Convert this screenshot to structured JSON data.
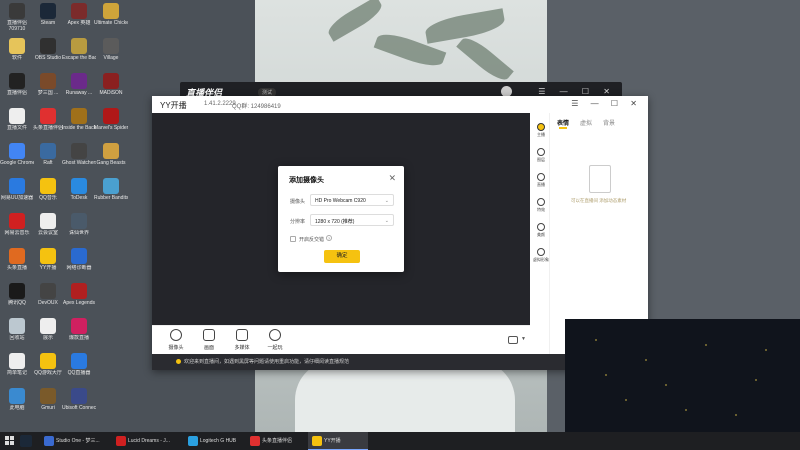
{
  "desktop": {
    "icons": [
      {
        "label": "直播伴侣",
        "sub": "709710",
        "col": 0,
        "row": 0,
        "color": "#3a3a3a"
      },
      {
        "label": "Steam",
        "col": 1,
        "row": 0,
        "color": "#1b2838"
      },
      {
        "label": "Apex 英雄",
        "col": 2,
        "row": 0,
        "color": "#7b2b2b"
      },
      {
        "label": "Ultimate Chicke...",
        "col": 3,
        "row": 0,
        "color": "#cfa43a"
      },
      {
        "label": "软件",
        "col": 0,
        "row": 1,
        "color": "#e6c45a"
      },
      {
        "label": "OBS Studio",
        "col": 1,
        "row": 1,
        "color": "#303030"
      },
      {
        "label": "Escape the Backrooms",
        "col": 2,
        "row": 1,
        "color": "#b89b40"
      },
      {
        "label": "Village",
        "col": 3,
        "row": 1,
        "color": "#5b5b5b"
      },
      {
        "label": "直播伴侣",
        "col": 0,
        "row": 2,
        "color": "#222"
      },
      {
        "label": "梦三国 ...",
        "col": 1,
        "row": 2,
        "color": "#7a4a2a"
      },
      {
        "label": "Runaway ...",
        "col": 2,
        "row": 2,
        "color": "#6b2a8a"
      },
      {
        "label": "MADiSON",
        "col": 3,
        "row": 2,
        "color": "#8a2020"
      },
      {
        "label": "直播文件",
        "col": 0,
        "row": 3,
        "color": "#eeeeee"
      },
      {
        "label": "头条直播伴侣",
        "col": 1,
        "row": 3,
        "color": "#e03030"
      },
      {
        "label": "Inside the Backrooms",
        "col": 2,
        "row": 3,
        "color": "#a0701a"
      },
      {
        "label": "Marvel's Spider-M...",
        "col": 3,
        "row": 3,
        "color": "#b01818"
      },
      {
        "label": "Google Chrome",
        "col": 0,
        "row": 4,
        "color": "#4285f4"
      },
      {
        "label": "Raft",
        "col": 1,
        "row": 4,
        "color": "#3a6aa0"
      },
      {
        "label": "Ghost Watchers",
        "col": 2,
        "row": 4,
        "color": "#444"
      },
      {
        "label": "Gang Beasts",
        "col": 3,
        "row": 4,
        "color": "#d0a040"
      },
      {
        "label": "网易UU加速器",
        "col": 0,
        "row": 5,
        "color": "#2a7ae0"
      },
      {
        "label": "QQ音乐",
        "col": 1,
        "row": 5,
        "color": "#f5c210"
      },
      {
        "label": "ToDesk",
        "col": 2,
        "row": 5,
        "color": "#2a8ae0"
      },
      {
        "label": "Rubber Bandits",
        "col": 3,
        "row": 5,
        "color": "#4aa0d0"
      },
      {
        "label": "网易云音乐",
        "col": 0,
        "row": 6,
        "color": "#d02020"
      },
      {
        "label": "云会议室",
        "col": 1,
        "row": 6,
        "color": "#eeeeee"
      },
      {
        "label": "诛仙世界",
        "col": 2,
        "row": 6,
        "color": "#4a5a6a"
      },
      {
        "label": "头条直播",
        "col": 0,
        "row": 7,
        "color": "#e06a20"
      },
      {
        "label": "YY开播",
        "col": 1,
        "row": 7,
        "color": "#f5c210"
      },
      {
        "label": "网络诊断器",
        "col": 2,
        "row": 7,
        "color": "#2a6ad0"
      },
      {
        "label": "腾讯QQ",
        "col": 0,
        "row": 8,
        "color": "#1a1a1a"
      },
      {
        "label": "DevOUX",
        "col": 1,
        "row": 8,
        "color": "#444"
      },
      {
        "label": "Apex Legends",
        "col": 2,
        "row": 8,
        "color": "#b02020"
      },
      {
        "label": "回收站",
        "col": 0,
        "row": 9,
        "color": "#bcc8d0"
      },
      {
        "label": "展示",
        "col": 1,
        "row": 9,
        "color": "#eeeeee"
      },
      {
        "label": "爆款直播",
        "col": 2,
        "row": 9,
        "color": "#d02060"
      },
      {
        "label": "简单笔记",
        "col": 0,
        "row": 10,
        "color": "#eeeeee"
      },
      {
        "label": "QQ游戏大厅",
        "col": 1,
        "row": 10,
        "color": "#f5c210"
      },
      {
        "label": "QQ直播器",
        "col": 2,
        "row": 10,
        "color": "#2a7ae0"
      },
      {
        "label": "此电脑",
        "col": 0,
        "row": 11,
        "color": "#3a8ad0"
      },
      {
        "label": "Gmuri",
        "col": 1,
        "row": 11,
        "color": "#7a5a2a"
      },
      {
        "label": "Ubisoft Connect",
        "col": 2,
        "row": 11,
        "color": "#3a4a8a"
      }
    ]
  },
  "bg_app": {
    "title": "直播伴侣",
    "badge": "测试"
  },
  "yy": {
    "title": "YY开播",
    "version": "1.41.2.2229",
    "qq": "QQ群: 124986419",
    "toolbar": [
      {
        "label": "摄像头",
        "icon": "camera-icon"
      },
      {
        "label": "画面",
        "icon": "image-icon"
      },
      {
        "label": "多媒体",
        "icon": "media-icon"
      },
      {
        "label": "一起玩",
        "icon": "gamepad-icon"
      }
    ],
    "notice": "欢迎来到直播间，如遇到黑屏等问题请使用重启功能，请仔细阅读直播规范",
    "side": [
      {
        "label": "主播",
        "active": true
      },
      {
        "label": "图层",
        "active": false
      },
      {
        "label": "直播",
        "active": false
      },
      {
        "label": "特效",
        "active": false
      },
      {
        "label": "美颜",
        "active": false
      },
      {
        "label": "虚拟形象",
        "active": false
      }
    ],
    "panel": {
      "tabs": [
        "表情",
        "虚拟",
        "背景"
      ],
      "active_tab": 0,
      "empty_text": "可以在直播间 添加动态素材"
    }
  },
  "modal": {
    "title": "添加摄像头",
    "camera_label": "摄像头",
    "camera_value": "HD Pro Webcam C920",
    "resolution_label": "分辨率",
    "resolution_value": "1280 x 720 (推荐)",
    "checkbox_label": "开启反交错",
    "ok_label": "确定"
  },
  "taskbar": {
    "tasks": [
      {
        "label": "Studio One - 梦三...",
        "color": "#3a6ad0",
        "active": false
      },
      {
        "label": "Lucid Dreams - J...",
        "color": "#d02020",
        "active": false
      },
      {
        "label": "Logitech G HUB",
        "color": "#2aa0e0",
        "active": false
      },
      {
        "label": "头条直播伴侣",
        "color": "#e03030",
        "active": false
      },
      {
        "label": "YY开播",
        "color": "#f5c210",
        "active": true
      }
    ]
  },
  "colors": {
    "accent": "#f5c210",
    "dark": "#24252a"
  }
}
